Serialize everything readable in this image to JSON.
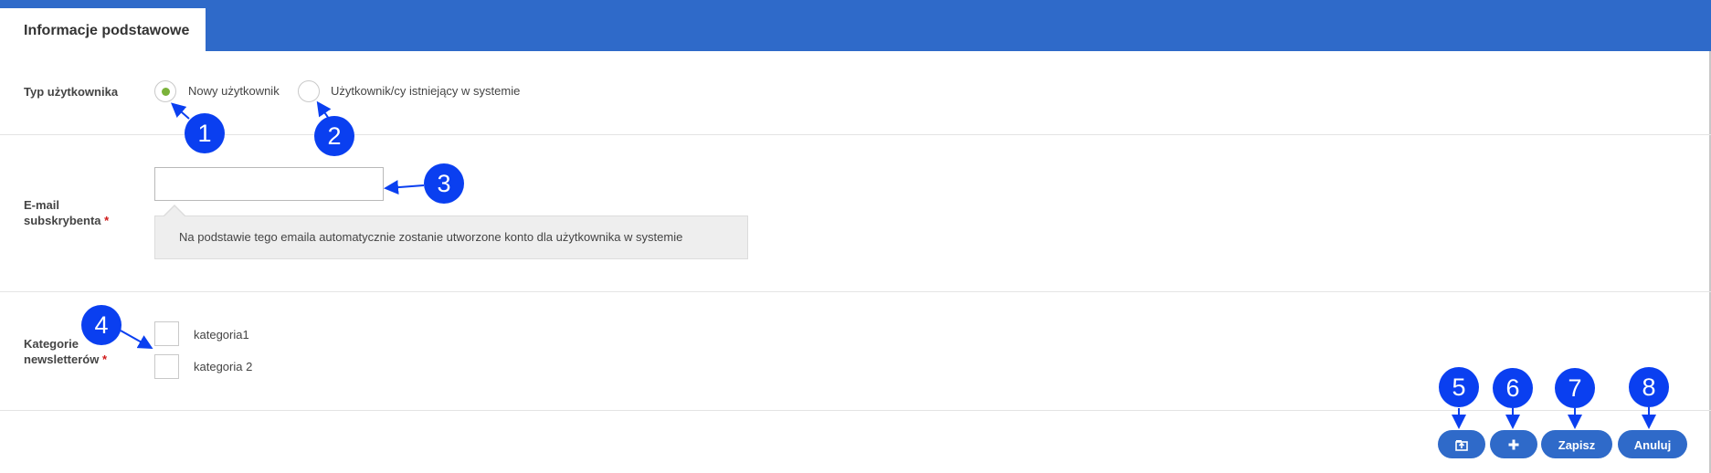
{
  "tabs": [
    {
      "label": "Informacje podstawowe",
      "active": true
    }
  ],
  "form": {
    "user_type": {
      "label": "Typ użytkownika",
      "options": [
        {
          "label": "Nowy użytkownik",
          "selected": true
        },
        {
          "label": "Użytkownik/cy istniejący w systemie",
          "selected": false
        }
      ]
    },
    "email": {
      "label_line1": "E-mail",
      "label_line2": "subskrybenta",
      "required_mark": "*",
      "value": "",
      "hint": "Na podstawie tego emaila automatycznie zostanie utworzone konto dla użytkownika w systemie"
    },
    "categories": {
      "label_line1": "Kategorie",
      "label_line2": "newsletterów",
      "required_mark": "*",
      "items": [
        {
          "label": "kategoria1",
          "checked": false
        },
        {
          "label": "kategoria 2",
          "checked": false
        }
      ]
    }
  },
  "actions": {
    "back_icon": "return-to-list-icon",
    "add_icon": "plus-icon",
    "save_label": "Zapisz",
    "cancel_label": "Anuluj"
  },
  "callouts": [
    "1",
    "2",
    "3",
    "4",
    "5",
    "6",
    "7",
    "8"
  ],
  "colors": {
    "header_bar": "#2f6ac9",
    "button": "#2f6ac9",
    "radio_selected": "#7ab23a",
    "required": "#d01919",
    "callout": "#0a3ff0"
  }
}
